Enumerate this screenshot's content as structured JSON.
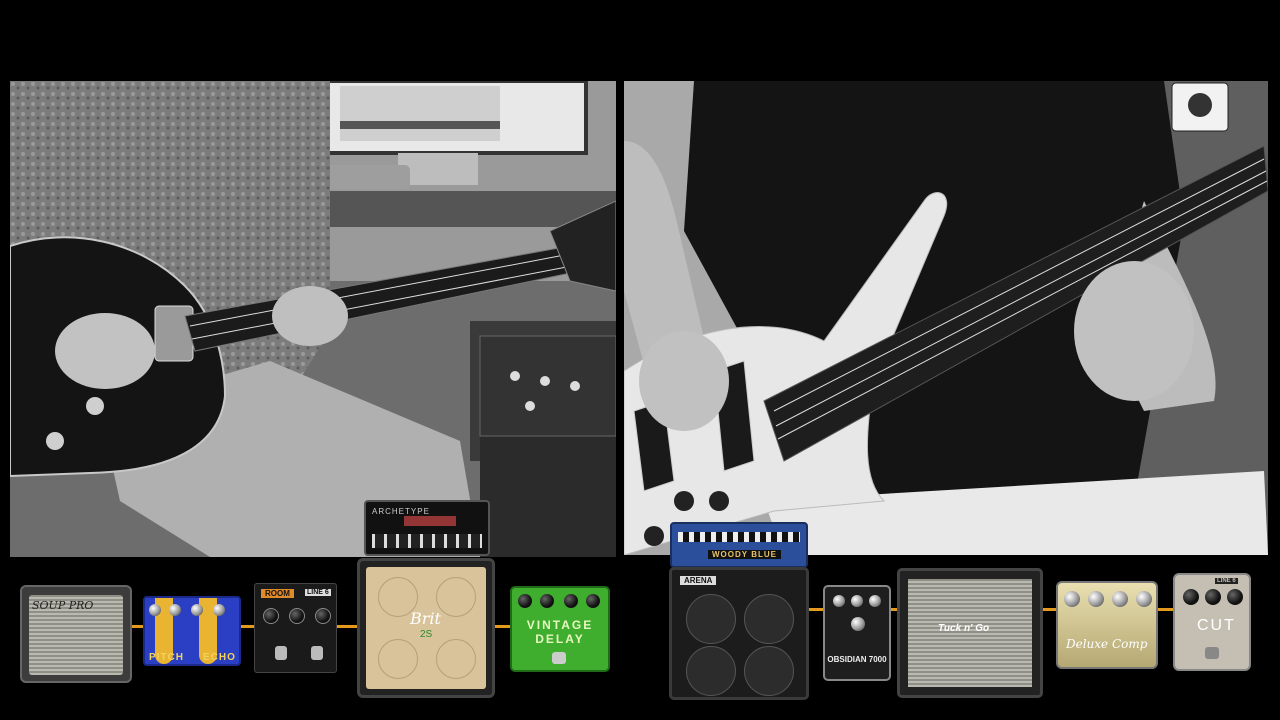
{
  "video": {
    "left_panel": {
      "subject": "guitarist playing black electric guitar"
    },
    "right_panel": {
      "subject": "bassist playing white five-string bass"
    }
  },
  "guitar_rig": {
    "amp_soup_pro": "SOUP PRO",
    "pitch_echo_pedal": {
      "left": "PITCH",
      "right": "ECHO"
    },
    "room_reverb": "ROOM",
    "line6_logo": "LINE 6",
    "archetype_head": "ARCHETYPE",
    "brit_cab": {
      "name": "Brit",
      "model": "2S"
    },
    "vintage_delay": "VINTAGE DELAY"
  },
  "bass_rig": {
    "woody_blue_head": "WOODY BLUE",
    "ampeg_cab_logo": "ARENA",
    "obsidian_pedal": "OBSIDIAN 7000",
    "tuck_n_go_cab": "Tuck n' Go",
    "deluxe_comp": "Deluxe Comp",
    "cut_pedal": "CUT",
    "line6_logo": "LINE 6"
  },
  "colors": {
    "cable": "#e39a1f",
    "background": "#000000"
  }
}
